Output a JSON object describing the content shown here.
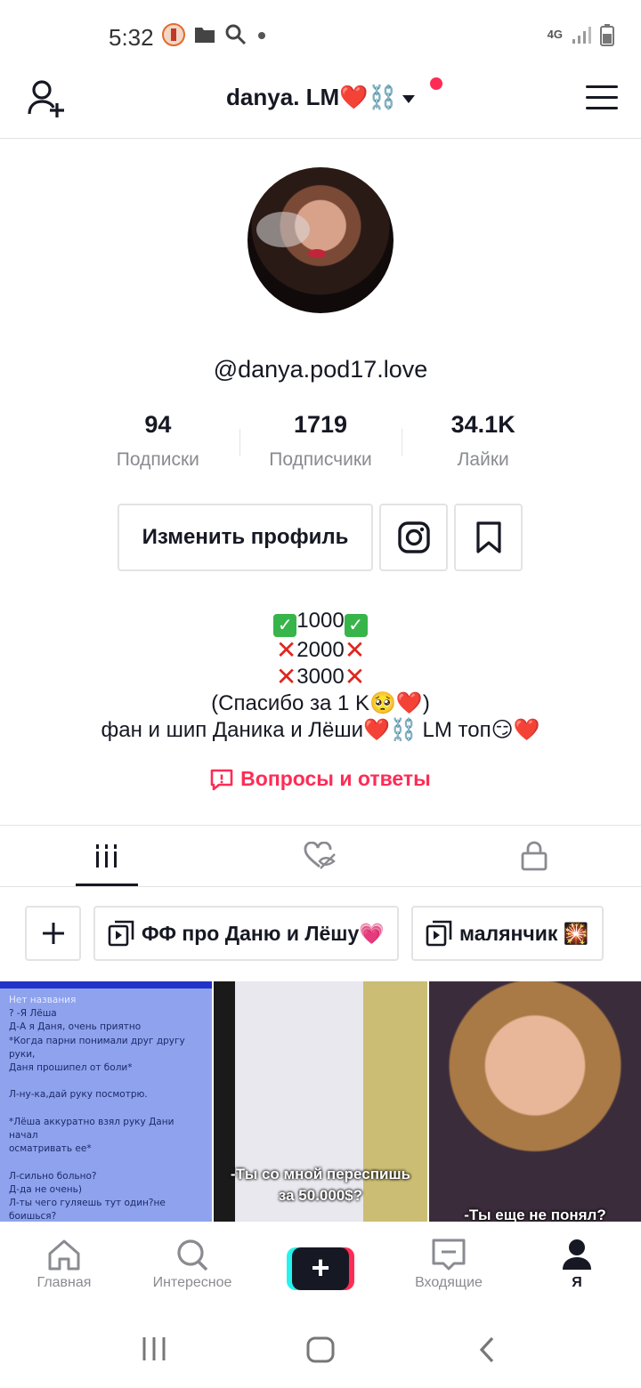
{
  "status_bar": {
    "time": "5:32",
    "network": "4G"
  },
  "header": {
    "account_name": "danya. LM❤️⛓️"
  },
  "profile": {
    "handle": "@danya.pod17.love",
    "stats": [
      {
        "value": "94",
        "label": "Подписки"
      },
      {
        "value": "1719",
        "label": "Подписчики"
      },
      {
        "value": "34.1K",
        "label": "Лайки"
      }
    ],
    "edit_label": "Изменить профиль",
    "bio": {
      "line1": "1000",
      "line2": "2000",
      "line3": "3000",
      "line4": "(Спасибо за 1 K🥺❤️)",
      "line5": "фан и шип Даника и Лёши❤️⛓️ LM топ😏❤️"
    },
    "qa_label": "Вопросы и ответы"
  },
  "tabs": [
    "videos",
    "liked-hidden",
    "private"
  ],
  "playlists": [
    {
      "label": "ФФ про Даню и Лёшу💗"
    },
    {
      "label": "малянчик 🎇"
    }
  ],
  "videos": [
    {
      "title": "Нет названия",
      "text": "? -Я Лёша\nД-А я Даня, очень приятно\n*Когда парни понимали друг другу руки,\nДаня прошипел от боли*\n\nЛ-ну-ка,дай руку посмотрю.\n\n*Лёша аккуратно взял руку Дани начал\nосматривать ее*\n\nЛ-сильно больно?\nД-да не очень)\nЛ-ты чего гуляешь тут один?не\nбоишься?\nД-да мне гулять не с кем, а ты чего\nгуляешь один ,а?"
    },
    {
      "caption1": "-Ты со мной переспишь",
      "caption2": "за 50.000$?"
    },
    {
      "caption": "-Ты еще не понял?"
    }
  ],
  "bottom_nav": [
    {
      "label": "Главная"
    },
    {
      "label": "Интересное"
    },
    {
      "label": "Входящие"
    },
    {
      "label": "Я"
    }
  ],
  "colors": {
    "accent": "#fe2c55",
    "text": "#161823",
    "muted": "#8a8b91",
    "border": "#e3e3e4"
  }
}
